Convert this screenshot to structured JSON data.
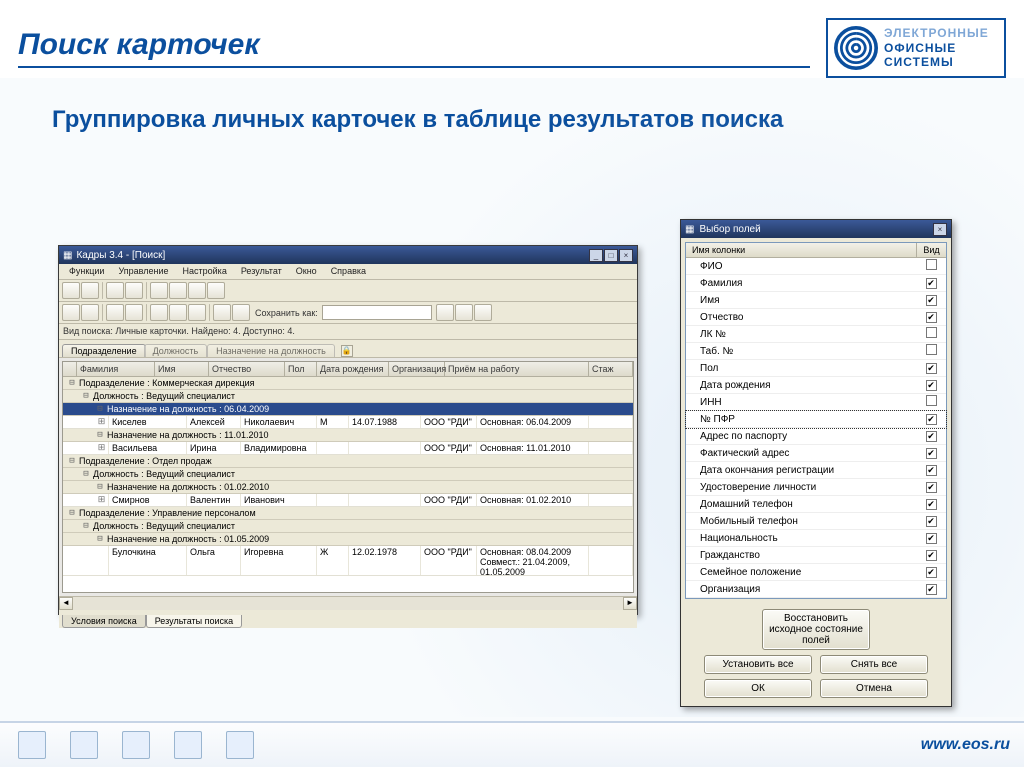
{
  "slide": {
    "title": "Поиск карточек",
    "subtitle": "Группировка личных карточек в таблице результатов поиска"
  },
  "logo": {
    "line1": "ЭЛЕКТРОННЫЕ",
    "line2": "ОФИСНЫЕ",
    "line3": "СИСТЕМЫ"
  },
  "footer": {
    "url": "www.eos.ru"
  },
  "app": {
    "title": "Кадры 3.4 - [Поиск]",
    "menu": [
      "Функции",
      "Управление",
      "Настройка",
      "Результат",
      "Окно",
      "Справка"
    ],
    "save_label": "Сохранить как:",
    "info": "Вид поиска: Личные карточки. Найдено: 4. Доступно: 4.",
    "top_tabs": {
      "t1": "Подразделение",
      "t2": "Должность",
      "t3": "Назначение на должность"
    },
    "columns": {
      "fam": "Фамилия",
      "name": "Имя",
      "ot": "Отчество",
      "pol": "Пол",
      "dob": "Дата рождения",
      "org": "Организация",
      "hire": "Приём на работу",
      "st": "Стаж"
    },
    "groups": {
      "g1": "Подразделение : Коммерческая дирекция",
      "g1a": "Должность : Ведущий специалист",
      "g1a1": "Назначение на должность : 06.04.2009",
      "g1a2": "Назначение на должность : 11.01.2010",
      "g2": "Подразделение : Отдел продаж",
      "g2a": "Должность : Ведущий специалист",
      "g2a1": "Назначение на должность : 01.02.2010",
      "g3": "Подразделение : Управление персоналом",
      "g3a": "Должность : Ведущий специалист",
      "g3a1": "Назначение на должность : 01.05.2009"
    },
    "rows": {
      "r1": {
        "fam": "Киселев",
        "name": "Алексей",
        "ot": "Николаевич",
        "pol": "М",
        "dob": "14.07.1988",
        "org": "ООО \"РДИ\"",
        "hire": "Основная: 06.04.2009"
      },
      "r2": {
        "fam": "Васильева",
        "name": "Ирина",
        "ot": "Владимировна",
        "pol": "",
        "dob": "",
        "org": "ООО \"РДИ\"",
        "hire": "Основная: 11.01.2010"
      },
      "r3": {
        "fam": "Смирнов",
        "name": "Валентин",
        "ot": "Иванович",
        "pol": "",
        "dob": "",
        "org": "ООО \"РДИ\"",
        "hire": "Основная: 01.02.2010"
      },
      "r4": {
        "fam": "Булочкина",
        "name": "Ольга",
        "ot": "Игоревна",
        "pol": "Ж",
        "dob": "12.02.1978",
        "org": "ООО \"РДИ\"",
        "hire": "Основная: 08.04.2009\nСовмест.: 21.04.2009, 01.05.2009"
      }
    },
    "bottom_tabs": {
      "t1": "Условия поиска",
      "t2": "Результаты поиска"
    }
  },
  "dialog": {
    "title": "Выбор полей",
    "col_name": "Имя колонки",
    "col_view": "Вид",
    "fields": [
      {
        "label": "ФИО",
        "checked": false
      },
      {
        "label": "Фамилия",
        "checked": true
      },
      {
        "label": "Имя",
        "checked": true
      },
      {
        "label": "Отчество",
        "checked": true
      },
      {
        "label": "ЛК №",
        "checked": false
      },
      {
        "label": "Таб. №",
        "checked": false
      },
      {
        "label": "Пол",
        "checked": true
      },
      {
        "label": "Дата рождения",
        "checked": true
      },
      {
        "label": "ИНН",
        "checked": false
      },
      {
        "label": "№ ПФР",
        "checked": true,
        "selected": true
      },
      {
        "label": "Адрес по паспорту",
        "checked": true
      },
      {
        "label": "Фактический адрес",
        "checked": true
      },
      {
        "label": "Дата окончания регистрации",
        "checked": true
      },
      {
        "label": "Удостоверение личности",
        "checked": true
      },
      {
        "label": "Домашний телефон",
        "checked": true
      },
      {
        "label": "Мобильный телефон",
        "checked": true
      },
      {
        "label": "Национальность",
        "checked": true
      },
      {
        "label": "Гражданство",
        "checked": true
      },
      {
        "label": "Семейное положение",
        "checked": true
      },
      {
        "label": "Организация",
        "checked": true
      }
    ],
    "btn_restore": "Восстановить исходное состояние полей",
    "btn_set_all": "Установить все",
    "btn_clear_all": "Снять все",
    "btn_ok": "ОК",
    "btn_cancel": "Отмена"
  }
}
